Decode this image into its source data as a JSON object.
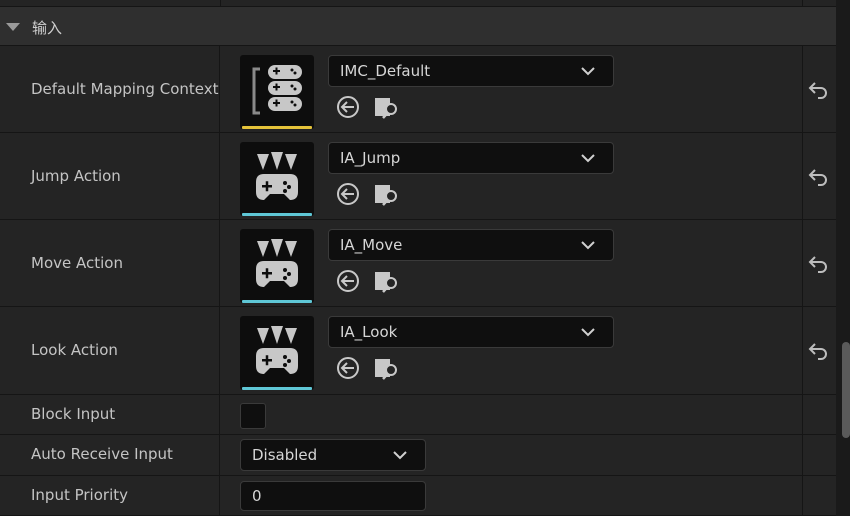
{
  "category": {
    "title": "输入"
  },
  "properties": [
    {
      "label": "Default Mapping Context",
      "value": "IMC_Default",
      "thumb_icon": "mapping-context-icon",
      "accent": "#e5c33a"
    },
    {
      "label": "Jump Action",
      "value": "IA_Jump",
      "thumb_icon": "input-action-icon",
      "accent": "#5fc7d6"
    },
    {
      "label": "Move Action",
      "value": "IA_Move",
      "thumb_icon": "input-action-icon",
      "accent": "#5fc7d6"
    },
    {
      "label": "Look Action",
      "value": "IA_Look",
      "thumb_icon": "input-action-icon",
      "accent": "#5fc7d6"
    }
  ],
  "block_input": {
    "label": "Block Input",
    "checked": false
  },
  "auto_receive_input": {
    "label": "Auto Receive Input",
    "value": "Disabled"
  },
  "input_priority": {
    "label": "Input Priority",
    "value": "0"
  }
}
